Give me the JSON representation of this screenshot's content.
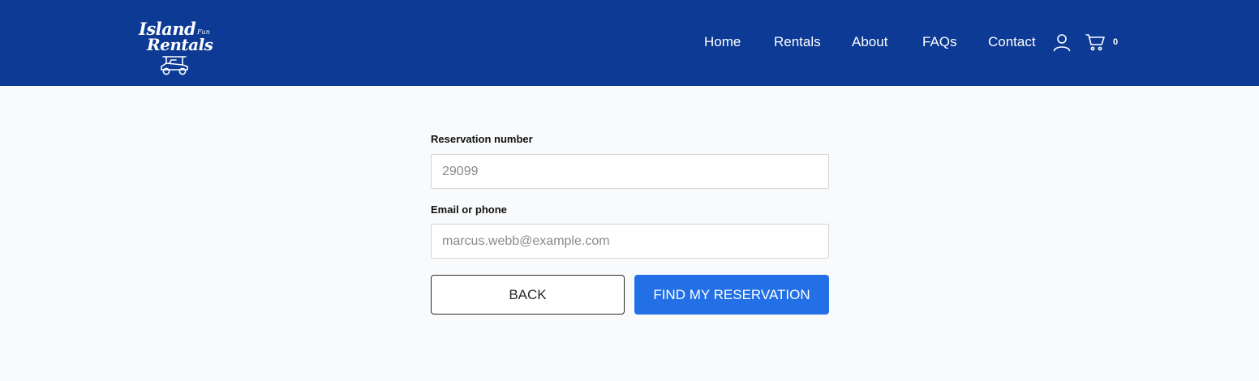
{
  "header": {
    "logo": {
      "word1": "Island",
      "word_small": "Fun",
      "word2": "Rentals",
      "icon": "golf-cart-icon"
    },
    "nav": [
      "Home",
      "Rentals",
      "About",
      "FAQs",
      "Contact"
    ],
    "account_icon": "user-icon",
    "cart_icon": "shopping-cart-icon",
    "cart_count": "0"
  },
  "form": {
    "reservation": {
      "label": "Reservation number",
      "placeholder": "29099",
      "value": ""
    },
    "contact": {
      "label": "Email or phone",
      "placeholder": "marcus.webb@example.com",
      "value": ""
    },
    "back_label": "BACK",
    "submit_label": "FIND MY RESERVATION"
  },
  "colors": {
    "header_bg": "#0c3a94",
    "page_bg": "#f8fafc",
    "primary_button": "#2370e6",
    "text_dark": "#1a1a1a"
  }
}
